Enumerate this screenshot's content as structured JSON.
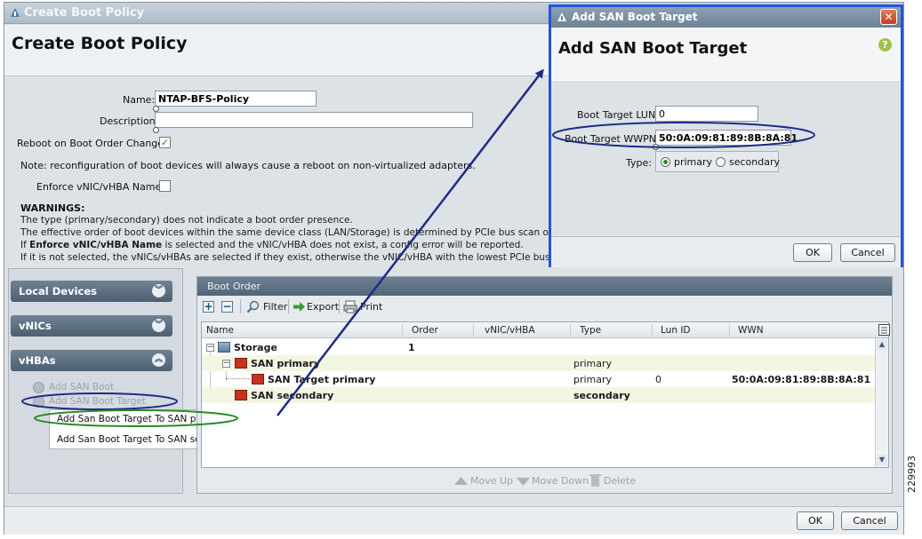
{
  "main": {
    "title": "Create Boot Policy",
    "heading": "Create Boot Policy",
    "form": {
      "name_label": "Name:",
      "name_value": "NTAP-BFS-Policy",
      "description_label": "Description:",
      "description_value": "",
      "reboot_label": "Reboot on Boot Order Change:",
      "reboot_checked": "✓",
      "note": "Note: reconfiguration of boot devices will always cause a reboot on non-virtualized adapters.",
      "enforce_label": "Enforce vNIC/vHBA Name:",
      "warnings_title": "WARNINGS:",
      "warning_1": "The type (primary/secondary) does not indicate a boot order presence.",
      "warning_2": "The effective order of boot devices within the same device class (LAN/Storage) is determined by PCIe bus scan order.",
      "warning_3_pre": "If ",
      "warning_3_bold": "Enforce vNIC/vHBA Name",
      "warning_3_post": " is selected and the vNIC/vHBA does not exist, a config error will be reported.",
      "warning_4": "If it is not selected, the vNICs/vHBAs are selected if they exist, otherwise the vNIC/vHBA with the lowest PCIe bus scan orc"
    },
    "ok_label": "OK",
    "cancel_label": "Cancel"
  },
  "left_panel": {
    "sections": [
      "Local Devices",
      "vNICs",
      "vHBAs"
    ],
    "add_san_boot": "Add SAN Boot",
    "add_san_boot_target": "Add SAN Boot Target",
    "context_menu": [
      "Add San Boot Target To SAN primary",
      "Add San Boot Target To SAN secondary"
    ]
  },
  "boot_order": {
    "title": "Boot Order",
    "toolbar": {
      "filter": "Filter",
      "export": "Export",
      "print": "Print",
      "add": "+",
      "remove": "−"
    },
    "columns": [
      "Name",
      "Order",
      "vNIC/vHBA",
      "Type",
      "Lun ID",
      "WWN"
    ],
    "rows": [
      {
        "name": "Storage",
        "order": "1",
        "vnic": "",
        "type": "",
        "lun": "",
        "wwn": ""
      },
      {
        "name": "SAN primary",
        "order": "",
        "vnic": "",
        "type": "primary",
        "lun": "",
        "wwn": ""
      },
      {
        "name": "SAN Target primary",
        "order": "",
        "vnic": "",
        "type": "primary",
        "lun": "0",
        "wwn": "50:0A:09:81:89:8B:8A:81"
      },
      {
        "name": "SAN secondary",
        "order": "",
        "vnic": "",
        "type": "secondary",
        "lun": "",
        "wwn": ""
      }
    ],
    "move_up": "Move Up",
    "move_down": "Move Down",
    "delete": "Delete"
  },
  "dialog": {
    "title": "Add SAN Boot Target",
    "heading": "Add SAN Boot Target",
    "lun_label": "Boot Target LUN:",
    "lun_value": "0",
    "wwpn_label": "Boot Target WWPN:",
    "wwpn_value": "50:0A:09:81:89:8B:8A:81",
    "type_label": "Type:",
    "type_options": [
      "primary",
      "secondary"
    ],
    "type_selected": "primary",
    "ok_label": "OK",
    "cancel_label": "Cancel",
    "close_glyph": "✕",
    "help_glyph": "?"
  },
  "figure_id": "229993",
  "colors": {
    "annotation_blue": "#1f2b86",
    "annotation_green": "#2a8a2a",
    "dialog_border": "#2553d8",
    "accordion_header": "#52667a"
  },
  "icons": [
    "cisco-icon",
    "checkmark-icon",
    "chevron-down-icon",
    "chevron-up-icon",
    "filter-icon",
    "export-icon",
    "print-icon",
    "storage-icon",
    "san-icon",
    "close-icon",
    "help-icon",
    "move-up-icon",
    "move-down-icon",
    "delete-icon"
  ]
}
